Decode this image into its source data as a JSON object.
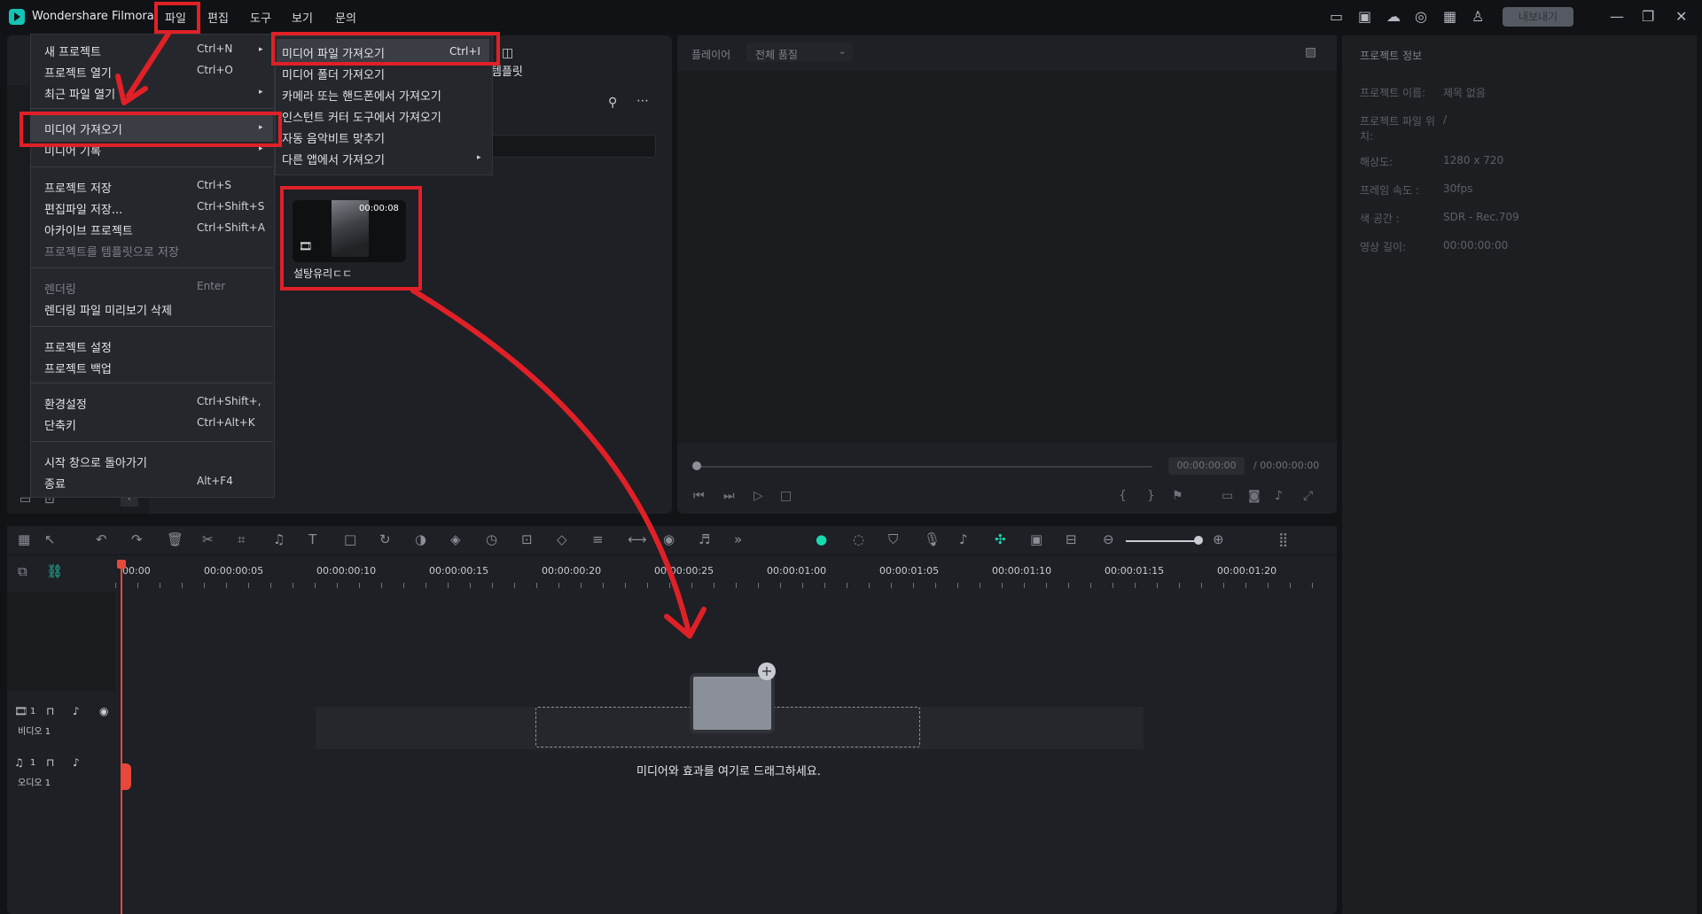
{
  "app": {
    "title": "Wondershare Filmora"
  },
  "menubar": {
    "file": "파일",
    "edit": "편집",
    "tools": "도구",
    "view": "보기",
    "help": "문의",
    "export": "내보내기"
  },
  "file_menu": {
    "items": [
      {
        "label": "새 프로젝트",
        "shortcut": "Ctrl+N"
      },
      {
        "label": "프로젝트 열기",
        "shortcut": "Ctrl+O"
      },
      {
        "label": "최근 파일 열기",
        "shortcut": ""
      },
      {
        "label": "미디어 가져오기",
        "shortcut": ""
      },
      {
        "label": "미디어 기록",
        "shortcut": ""
      },
      {
        "label": "프로젝트 저장",
        "shortcut": "Ctrl+S"
      },
      {
        "label": "편집파일 저장...",
        "shortcut": "Ctrl+Shift+S"
      },
      {
        "label": "아카이브 프로젝트",
        "shortcut": "Ctrl+Shift+A"
      },
      {
        "label": "프로젝트를 템플릿으로 저장",
        "shortcut": ""
      },
      {
        "label": "렌더링",
        "shortcut": "Enter"
      },
      {
        "label": "렌더링 파일 미리보기 삭제",
        "shortcut": ""
      },
      {
        "label": "프로젝트 설정",
        "shortcut": ""
      },
      {
        "label": "프로젝트 백업",
        "shortcut": ""
      },
      {
        "label": "환경설정",
        "shortcut": "Ctrl+Shift+,"
      },
      {
        "label": "단축키",
        "shortcut": "Ctrl+Alt+K"
      },
      {
        "label": "시작 창으로 돌아가기",
        "shortcut": ""
      },
      {
        "label": "종료",
        "shortcut": "Alt+F4"
      }
    ]
  },
  "import_menu": {
    "items": [
      {
        "label": "미디어 파일 가져오기",
        "shortcut": "Ctrl+I"
      },
      {
        "label": "미디어 폴더 가져오기",
        "shortcut": ""
      },
      {
        "label": "카메라 또는 핸드폰에서 가져오기",
        "shortcut": ""
      },
      {
        "label": "인스턴트 커터 도구에서 가져오기",
        "shortcut": ""
      },
      {
        "label": "자동 음악비트 맞추기",
        "shortcut": ""
      },
      {
        "label": "다른 앱에서 가져오기",
        "shortcut": ""
      }
    ]
  },
  "media": {
    "template_tab": "템플릿",
    "clip": {
      "name": "설탕유리ㄷㄷ",
      "duration": "00:00:08"
    }
  },
  "player": {
    "label": "플레이어",
    "quality": "전체 품질",
    "current_time": "00:00:00:00",
    "total_time": "/ 00:00:00:00"
  },
  "project_info": {
    "title": "프로젝트 정보",
    "rows": [
      {
        "key": "프로젝트 이름:",
        "value": "제목 없음"
      },
      {
        "key": "프로젝트 파일 위치:",
        "value": "/"
      },
      {
        "key": "해상도:",
        "value": "1280 x 720"
      },
      {
        "key": "프레임 속도 :",
        "value": "30fps"
      },
      {
        "key": "색 공간 :",
        "value": "SDR - Rec.709"
      },
      {
        "key": "영상 길이:",
        "value": "00:00:00:00"
      }
    ]
  },
  "timeline": {
    "ruler": [
      "00:00",
      "00:00:00:05",
      "00:00:00:10",
      "00:00:00:15",
      "00:00:00:20",
      "00:00:00:25",
      "00:00:01:00",
      "00:00:01:05",
      "00:00:01:10",
      "00:00:01:15",
      "00:00:01:20"
    ],
    "video_track": "비디오 1",
    "audio_track": "오디오 1",
    "track_num": "1",
    "drop_hint": "미디어와 효과를 여기로 드래그하세요."
  },
  "annotation_color": "#e02027"
}
